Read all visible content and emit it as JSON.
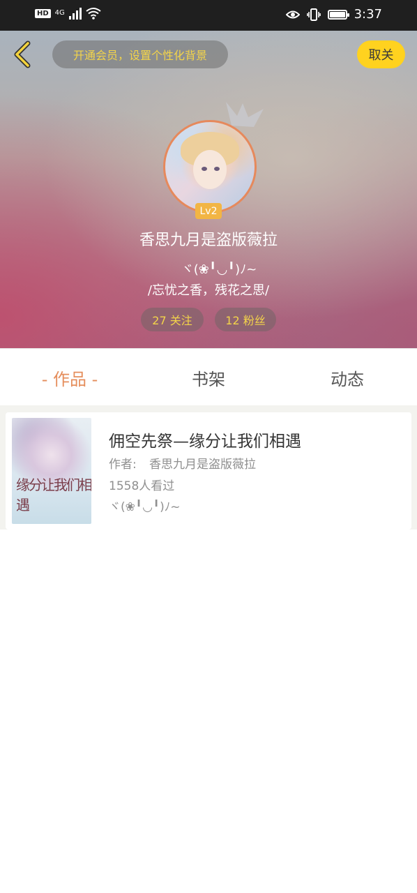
{
  "status_bar": {
    "hd_label": "HD",
    "network_label": "4G",
    "time": "3:37"
  },
  "header": {
    "vip_prompt": "开通会员，设置个性化背景",
    "unfollow_label": "取关",
    "level": "Lv2",
    "username": "香思九月是盗版薇拉",
    "signature_line1": "ヾ(❀╹◡╹)ﾉ~",
    "signature_line2": "/忘忧之香，残花之思/",
    "following_label": "27 关注",
    "fans_label": "12 粉丝"
  },
  "tabs": {
    "works": "- 作品 -",
    "shelf": "书架",
    "activity": "动态"
  },
  "works": [
    {
      "title": "佣空先祭—缘分让我们相遇",
      "author_label": "作者: ",
      "author": "香思九月是盗版薇拉",
      "views": "1558人看过",
      "description": "ヾ(❀╹◡╹)ﾉ~",
      "cover_title": "缘分让我们相遇"
    }
  ],
  "colors": {
    "accent_orange": "#e58e5c",
    "accent_yellow": "#ffd21f",
    "pill_text_yellow": "#f3d44a",
    "level_badge": "#f2b544"
  },
  "icons": [
    "back-arrow-icon",
    "crown-icon",
    "wifi-icon",
    "eye-icon",
    "vibrate-icon",
    "battery-icon",
    "signal-icon"
  ]
}
